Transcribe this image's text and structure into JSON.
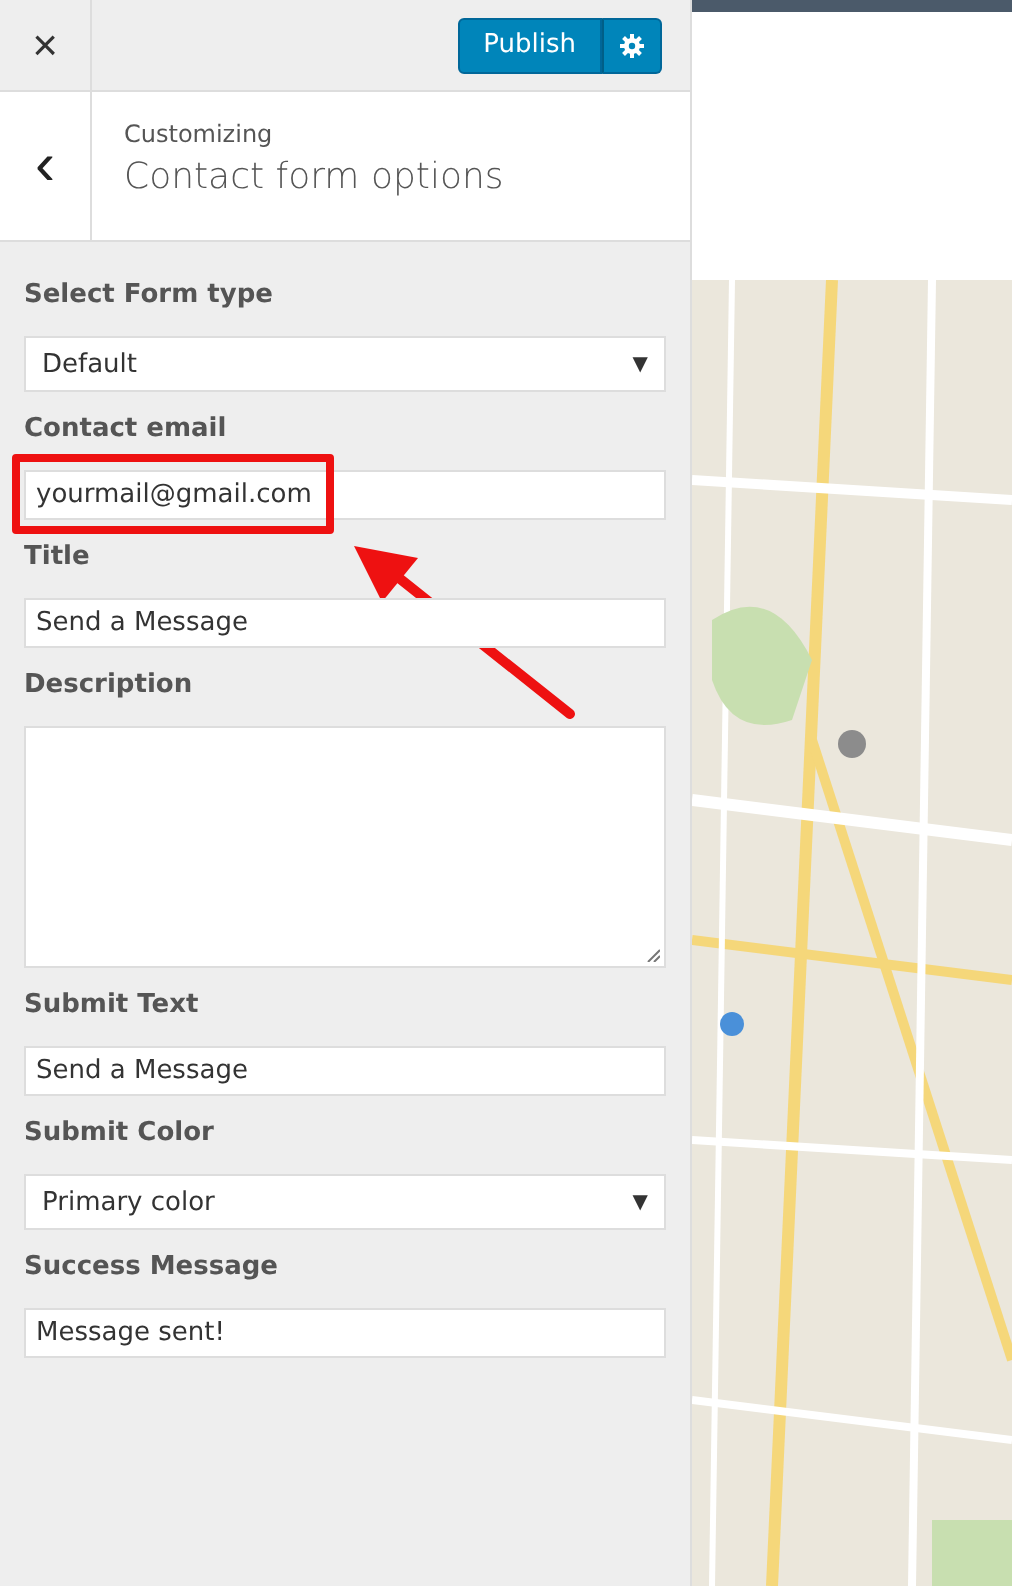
{
  "header": {
    "close": "×",
    "publish": "Publish"
  },
  "section": {
    "back": "‹",
    "breadcrumb": "Customizing",
    "title": "Contact form options"
  },
  "fields": [
    {
      "label": "Select Form type",
      "kind": "select",
      "value": "Default",
      "caret": "▼",
      "highlighted": false
    },
    {
      "label": "Contact email",
      "kind": "text",
      "value": "yourmail@gmail.com",
      "highlighted": true
    },
    {
      "label": "Title",
      "kind": "text",
      "value": "Send a Message",
      "highlighted": false
    },
    {
      "label": "Description",
      "kind": "textarea",
      "highlighted": false
    },
    {
      "label": "Submit Text",
      "kind": "text",
      "value": "Send a Message",
      "highlighted": false
    },
    {
      "label": "Submit Color",
      "kind": "select",
      "value": "Primary color",
      "caret": "▼",
      "highlighted": false
    },
    {
      "label": "Success Message",
      "kind": "text",
      "value": "Message sent!",
      "highlighted": false
    }
  ]
}
